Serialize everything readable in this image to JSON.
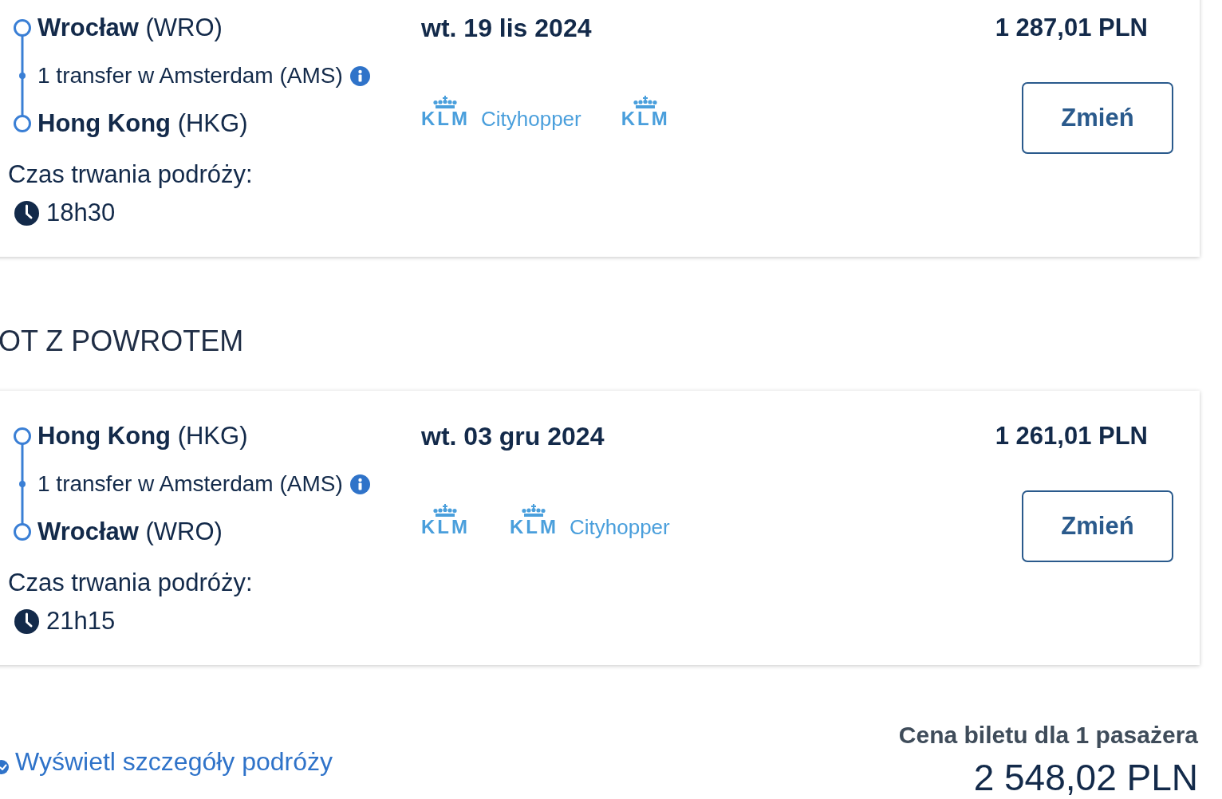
{
  "outbound_flight": {
    "origin": "**Wrocław** (WRO)",
    "transfer": "1 transfer w Amsterdam (AMS)",
    "destination": "**Hong Kong** (HKG)",
    "duration_label": "Czas trwania podróży:",
    "duration": "18h30",
    "date": "wt. 19 lis 2024",
    "airlines": [
      {
        "wordmark": "KLM",
        "subtitle": "Cityhopper"
      },
      {
        "wordmark": "KLM"
      }
    ],
    "price": "1 287,01 PLN",
    "button": "Zmień"
  },
  "return_heading": "OT Z POWROTEM",
  "return_flight": {
    "origin": "**Hong Kong** (HKG)",
    "transfer": "1 transfer w Amsterdam (AMS)",
    "destination": "**Wrocław** (WRO)",
    "duration_label": "Czas trwania podróży:",
    "duration": "21h15",
    "date": "wt. 03 gru 2024",
    "airlines": [
      {
        "wordmark": "KLM"
      },
      {
        "wordmark": "KLM",
        "subtitle": "Cityhopper"
      }
    ],
    "price": "1 261,01 PLN",
    "button": "Zmień"
  },
  "details_link": "Wyświetl szczegóły podróży",
  "fare_summary": {
    "label": "Cena biletu dla 1 pasażera",
    "total": "2 548,02 PLN"
  }
}
